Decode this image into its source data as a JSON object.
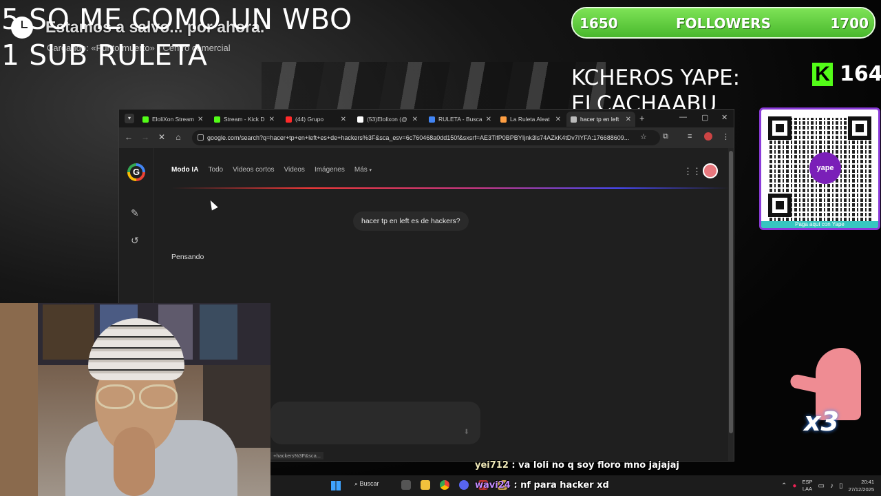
{
  "overlay": {
    "line1": "5 SO ME COMO UN WBO",
    "line2": "1 SUB RULETA",
    "game_objective": "Estamos a salvo... por ahora.",
    "game_subtitle": "Cargando: «Punto muerto» - Centro comercial",
    "kcheros": "KCHEROS YAPE: ELCACHAABU",
    "kick_count": "164",
    "kick_logo": "K",
    "multiplier": "x3"
  },
  "followers": {
    "min": "1650",
    "label": "FOLLOWERS",
    "max": "1700",
    "progress": 1.0
  },
  "qr": {
    "brand": "yape",
    "note": "Paga aquí con Yape"
  },
  "browser": {
    "tabs": [
      {
        "title": "EloliXon Stream",
        "color": "#53fc18"
      },
      {
        "title": "Stream - Kick D",
        "color": "#53fc18"
      },
      {
        "title": "(44) Grupo",
        "color": "#ff2a2a"
      },
      {
        "title": "(53)Elolixon (@",
        "color": "#ffffff"
      },
      {
        "title": "RULETA - Busca",
        "color": "#4285f4"
      },
      {
        "title": "La Ruleta Aleat",
        "color": "#ff9f43"
      },
      {
        "title": "hacer tp en left",
        "color": "#bbbbbb"
      }
    ],
    "url": "google.com/search?q=hacer+tp+en+left+es+de+hackers%3F&sca_esv=6c760468a0dd150f&sxsrf=AE3TifP0BPBYIjnk3ls74AZkK4tDv7IYFA:176688609...",
    "status_url": "+hackers%3F&sca..."
  },
  "search": {
    "tabs": [
      "Modo IA",
      "Todo",
      "Videos cortos",
      "Videos",
      "Imágenes",
      "Más"
    ],
    "query": "hacer tp en left es de hackers?",
    "thinking": "Pensando"
  },
  "chat": [
    {
      "user": "yei712",
      "message": ": va loli no q soy floro mno jajajaj"
    },
    {
      "user": "wavi24",
      "message": ": nf para hacker xd"
    }
  ],
  "taskbar": {
    "search": "Buscar",
    "lang_top": "ESP",
    "lang_bottom": "LAA",
    "time": "20:41",
    "date": "27/12/2025"
  },
  "colors": {
    "accent": "#53fc18",
    "followers_fill": "#7ee357",
    "yape": "#7a1fb8"
  }
}
